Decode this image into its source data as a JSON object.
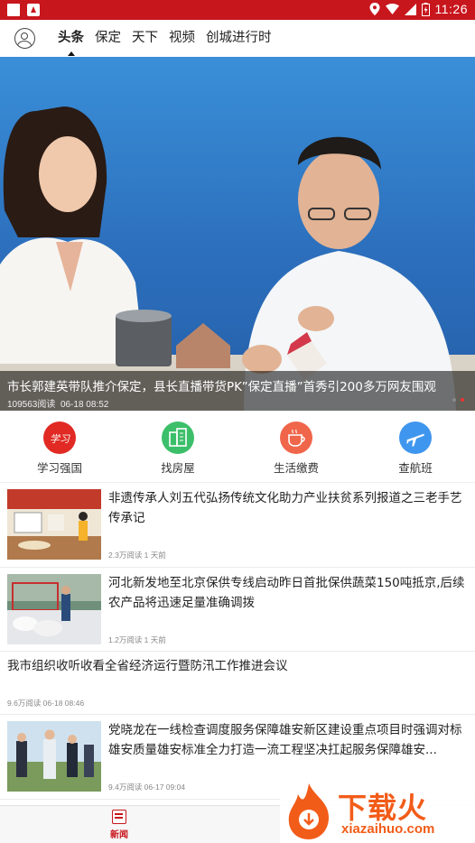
{
  "status_bar": {
    "time": "11:26"
  },
  "top_nav": {
    "tabs": [
      {
        "label": "头条",
        "active": true
      },
      {
        "label": "保定",
        "active": false
      },
      {
        "label": "天下",
        "active": false
      },
      {
        "label": "视频",
        "active": false
      },
      {
        "label": "创城进行时",
        "active": false
      }
    ]
  },
  "hero": {
    "title": "市长郭建英带队推介保定，县长直播带货PK”保定直播”首秀引200多万网友围观",
    "reads": "109563阅读",
    "date": "06-18 08:52"
  },
  "quick_links": [
    {
      "label": "学习强国",
      "icon": "xuexi-qiangguo-icon",
      "color": "#e02a23"
    },
    {
      "label": "找房屋",
      "icon": "building-icon",
      "color": "#3cbf6a"
    },
    {
      "label": "生活缴费",
      "icon": "coffee-cup-icon",
      "color": "#f0664a"
    },
    {
      "label": "查航班",
      "icon": "airplane-icon",
      "color": "#3f96ee"
    }
  ],
  "news": [
    {
      "title": "非遗传承人刘五代弘扬传统文化助力产业扶贫系列报道之三老手艺传承记",
      "meta": "2.3万阅读 1 天前"
    },
    {
      "title": "河北新发地至北京保供专线启动昨日首批保供蔬菜150吨抵京,后续农产品将迅速足量准确调拨",
      "meta": "1.2万阅读 1 天前"
    },
    {
      "title": "我市组织收听收看全省经济运行暨防汛工作推进会议",
      "meta": "9.6万阅读 06-18 08:46"
    },
    {
      "title": "党晓龙在一线检查调度服务保障雄安新区建设重点项目时强调对标雄安质量雄安标准全力打造一流工程坚决扛起服务保障雄安...",
      "meta": "9.4万阅读 06-17 09:04"
    }
  ],
  "bottom_bar": {
    "news_label": "新闻"
  },
  "watermark": {
    "brand": "下载火",
    "url": "xiazaihuo.com"
  }
}
